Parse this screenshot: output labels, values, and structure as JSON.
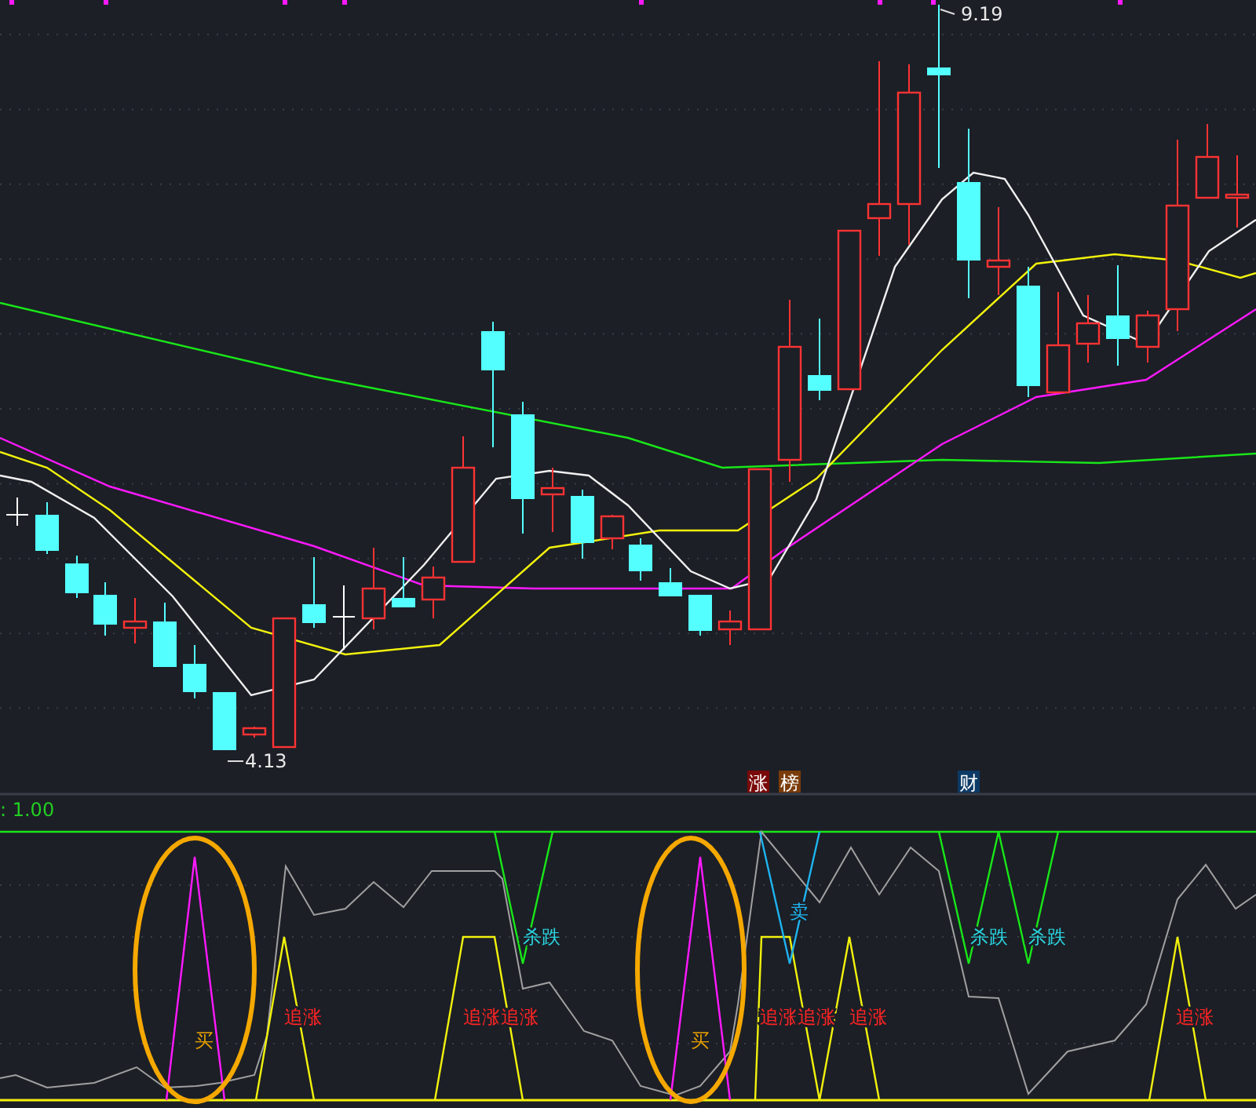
{
  "price_chart": {
    "high_label": "9.19",
    "low_label": "4.13",
    "badges": [
      {
        "text": "涨",
        "color": "#7a0a0a"
      },
      {
        "text": "榜",
        "color": "#7a3c0a"
      },
      {
        "text": "财",
        "color": "#0c3a66"
      }
    ]
  },
  "indicator": {
    "legend": ": 1.00",
    "signals": [
      {
        "kind": "buy",
        "text": "买"
      },
      {
        "kind": "chase",
        "text": "追涨"
      },
      {
        "kind": "chase",
        "text": "追涨"
      },
      {
        "kind": "chase",
        "text": "追涨"
      },
      {
        "kind": "kill",
        "text": "杀跌"
      },
      {
        "kind": "buy",
        "text": "买"
      },
      {
        "kind": "chase",
        "text": "追涨"
      },
      {
        "kind": "chase",
        "text": "追涨"
      },
      {
        "kind": "sell",
        "text": "卖"
      },
      {
        "kind": "chase",
        "text": "追涨"
      },
      {
        "kind": "kill",
        "text": "杀跌"
      },
      {
        "kind": "kill",
        "text": "杀跌"
      },
      {
        "kind": "chase",
        "text": "追涨"
      }
    ]
  }
}
